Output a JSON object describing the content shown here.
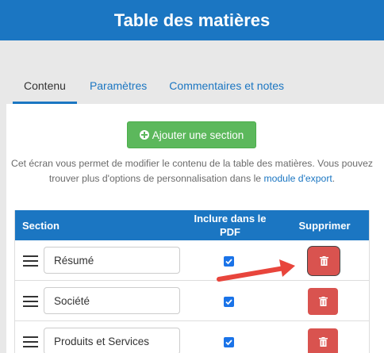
{
  "header": {
    "title": "Table des matières"
  },
  "tabs": [
    {
      "label": "Contenu",
      "active": true
    },
    {
      "label": "Paramètres",
      "active": false
    },
    {
      "label": "Commentaires et notes",
      "active": false
    }
  ],
  "add_button": {
    "label": "Ajouter une section",
    "icon": "plus-circle-icon"
  },
  "description": {
    "text": "Cet écran vous permet de modifier le contenu de la table des matières. Vous pouvez trouver plus d'options de personnalisation dans le ",
    "link": "module d'export",
    "suffix": "."
  },
  "table": {
    "headers": {
      "section": "Section",
      "include": "Inclure dans le PDF",
      "delete": "Supprimer"
    },
    "rows": [
      {
        "name": "Résumé",
        "included": true
      },
      {
        "name": "Société",
        "included": true
      },
      {
        "name": "Produits et Services",
        "included": true
      }
    ]
  },
  "colors": {
    "primary": "#1b76c2",
    "success": "#5cb85c",
    "danger": "#d9534f",
    "annotation_arrow": "#e8453c"
  }
}
